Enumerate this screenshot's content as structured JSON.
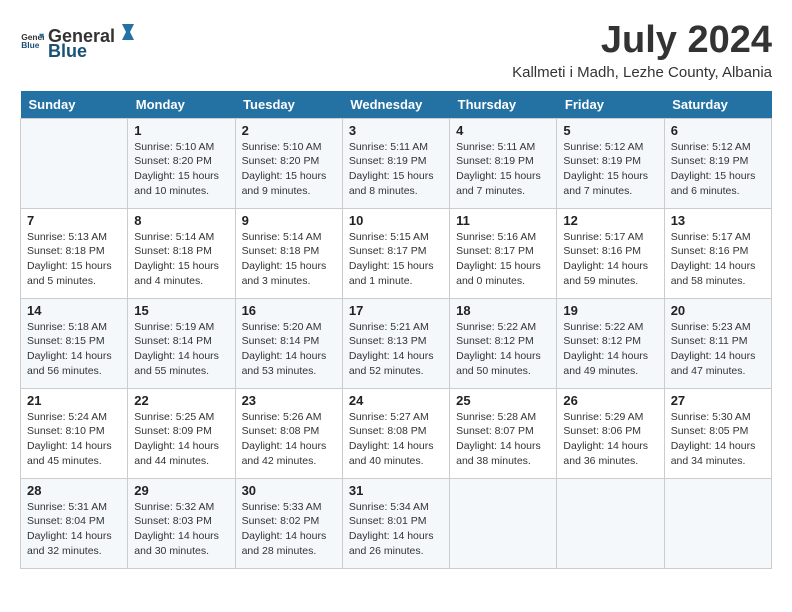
{
  "header": {
    "logo_general": "General",
    "logo_blue": "Blue",
    "month": "July 2024",
    "location": "Kallmeti i Madh, Lezhe County, Albania"
  },
  "weekdays": [
    "Sunday",
    "Monday",
    "Tuesday",
    "Wednesday",
    "Thursday",
    "Friday",
    "Saturday"
  ],
  "weeks": [
    [
      {
        "day": "",
        "info": ""
      },
      {
        "day": "1",
        "info": "Sunrise: 5:10 AM\nSunset: 8:20 PM\nDaylight: 15 hours\nand 10 minutes."
      },
      {
        "day": "2",
        "info": "Sunrise: 5:10 AM\nSunset: 8:20 PM\nDaylight: 15 hours\nand 9 minutes."
      },
      {
        "day": "3",
        "info": "Sunrise: 5:11 AM\nSunset: 8:19 PM\nDaylight: 15 hours\nand 8 minutes."
      },
      {
        "day": "4",
        "info": "Sunrise: 5:11 AM\nSunset: 8:19 PM\nDaylight: 15 hours\nand 7 minutes."
      },
      {
        "day": "5",
        "info": "Sunrise: 5:12 AM\nSunset: 8:19 PM\nDaylight: 15 hours\nand 7 minutes."
      },
      {
        "day": "6",
        "info": "Sunrise: 5:12 AM\nSunset: 8:19 PM\nDaylight: 15 hours\nand 6 minutes."
      }
    ],
    [
      {
        "day": "7",
        "info": "Sunrise: 5:13 AM\nSunset: 8:18 PM\nDaylight: 15 hours\nand 5 minutes."
      },
      {
        "day": "8",
        "info": "Sunrise: 5:14 AM\nSunset: 8:18 PM\nDaylight: 15 hours\nand 4 minutes."
      },
      {
        "day": "9",
        "info": "Sunrise: 5:14 AM\nSunset: 8:18 PM\nDaylight: 15 hours\nand 3 minutes."
      },
      {
        "day": "10",
        "info": "Sunrise: 5:15 AM\nSunset: 8:17 PM\nDaylight: 15 hours\nand 1 minute."
      },
      {
        "day": "11",
        "info": "Sunrise: 5:16 AM\nSunset: 8:17 PM\nDaylight: 15 hours\nand 0 minutes."
      },
      {
        "day": "12",
        "info": "Sunrise: 5:17 AM\nSunset: 8:16 PM\nDaylight: 14 hours\nand 59 minutes."
      },
      {
        "day": "13",
        "info": "Sunrise: 5:17 AM\nSunset: 8:16 PM\nDaylight: 14 hours\nand 58 minutes."
      }
    ],
    [
      {
        "day": "14",
        "info": "Sunrise: 5:18 AM\nSunset: 8:15 PM\nDaylight: 14 hours\nand 56 minutes."
      },
      {
        "day": "15",
        "info": "Sunrise: 5:19 AM\nSunset: 8:14 PM\nDaylight: 14 hours\nand 55 minutes."
      },
      {
        "day": "16",
        "info": "Sunrise: 5:20 AM\nSunset: 8:14 PM\nDaylight: 14 hours\nand 53 minutes."
      },
      {
        "day": "17",
        "info": "Sunrise: 5:21 AM\nSunset: 8:13 PM\nDaylight: 14 hours\nand 52 minutes."
      },
      {
        "day": "18",
        "info": "Sunrise: 5:22 AM\nSunset: 8:12 PM\nDaylight: 14 hours\nand 50 minutes."
      },
      {
        "day": "19",
        "info": "Sunrise: 5:22 AM\nSunset: 8:12 PM\nDaylight: 14 hours\nand 49 minutes."
      },
      {
        "day": "20",
        "info": "Sunrise: 5:23 AM\nSunset: 8:11 PM\nDaylight: 14 hours\nand 47 minutes."
      }
    ],
    [
      {
        "day": "21",
        "info": "Sunrise: 5:24 AM\nSunset: 8:10 PM\nDaylight: 14 hours\nand 45 minutes."
      },
      {
        "day": "22",
        "info": "Sunrise: 5:25 AM\nSunset: 8:09 PM\nDaylight: 14 hours\nand 44 minutes."
      },
      {
        "day": "23",
        "info": "Sunrise: 5:26 AM\nSunset: 8:08 PM\nDaylight: 14 hours\nand 42 minutes."
      },
      {
        "day": "24",
        "info": "Sunrise: 5:27 AM\nSunset: 8:08 PM\nDaylight: 14 hours\nand 40 minutes."
      },
      {
        "day": "25",
        "info": "Sunrise: 5:28 AM\nSunset: 8:07 PM\nDaylight: 14 hours\nand 38 minutes."
      },
      {
        "day": "26",
        "info": "Sunrise: 5:29 AM\nSunset: 8:06 PM\nDaylight: 14 hours\nand 36 minutes."
      },
      {
        "day": "27",
        "info": "Sunrise: 5:30 AM\nSunset: 8:05 PM\nDaylight: 14 hours\nand 34 minutes."
      }
    ],
    [
      {
        "day": "28",
        "info": "Sunrise: 5:31 AM\nSunset: 8:04 PM\nDaylight: 14 hours\nand 32 minutes."
      },
      {
        "day": "29",
        "info": "Sunrise: 5:32 AM\nSunset: 8:03 PM\nDaylight: 14 hours\nand 30 minutes."
      },
      {
        "day": "30",
        "info": "Sunrise: 5:33 AM\nSunset: 8:02 PM\nDaylight: 14 hours\nand 28 minutes."
      },
      {
        "day": "31",
        "info": "Sunrise: 5:34 AM\nSunset: 8:01 PM\nDaylight: 14 hours\nand 26 minutes."
      },
      {
        "day": "",
        "info": ""
      },
      {
        "day": "",
        "info": ""
      },
      {
        "day": "",
        "info": ""
      }
    ]
  ]
}
